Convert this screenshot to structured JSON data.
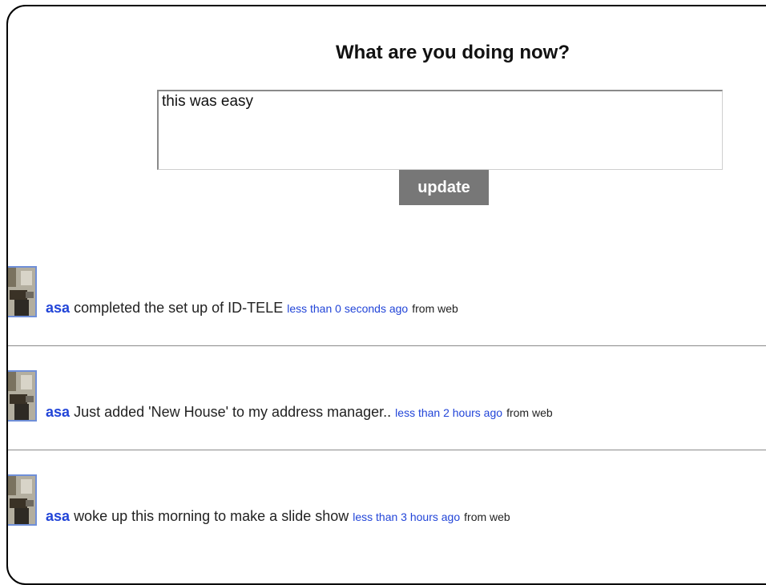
{
  "composer": {
    "title": "What are you doing now?",
    "input_value": "this was easy",
    "update_label": "update"
  },
  "feed": [
    {
      "user": "asa",
      "text": "completed the set up of ID-TELE",
      "time": "less than 0 seconds ago",
      "source": "from web"
    },
    {
      "user": "asa",
      "text": "Just added 'New House' to my address manager..",
      "time": "less than 2 hours ago",
      "source": "from web"
    },
    {
      "user": "asa",
      "text": "woke up this morning to make a slide show",
      "time": "less than 3 hours ago",
      "source": "from web"
    }
  ],
  "colors": {
    "link": "#2245d8",
    "button": "#777777",
    "avatar_border": "#6f8fd8"
  }
}
